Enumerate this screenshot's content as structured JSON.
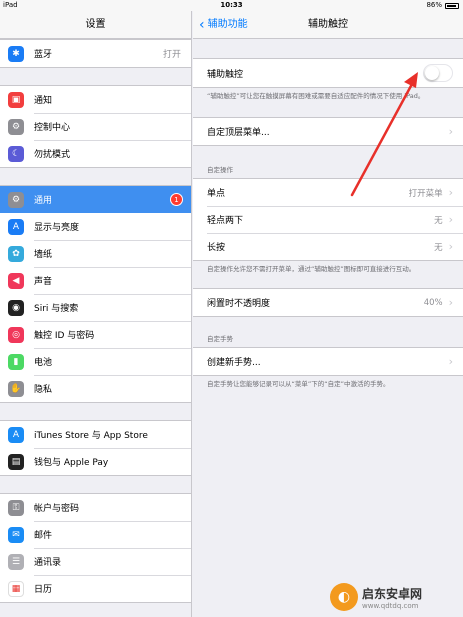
{
  "status_bar": {
    "device": "iPad",
    "time": "10:33",
    "battery": "86%",
    "battery_level": 0.86
  },
  "master": {
    "title": "设置",
    "groups": [
      [
        {
          "label": "蓝牙",
          "value": "打开",
          "icon": "bluetooth-icon",
          "color": "#1a7cf5",
          "glyph": "✱"
        }
      ],
      [
        {
          "label": "通知",
          "icon": "notification-icon",
          "color": "#f23e3e",
          "glyph": "▣"
        },
        {
          "label": "控制中心",
          "icon": "control-center-icon",
          "color": "#8e8e93",
          "glyph": "⚙"
        },
        {
          "label": "勿扰模式",
          "icon": "moon-icon",
          "color": "#5b5bd6",
          "glyph": "☾"
        }
      ],
      [
        {
          "label": "通用",
          "icon": "gear-icon",
          "color": "#8e8e93",
          "glyph": "⚙",
          "badge": "1",
          "selected": true
        },
        {
          "label": "显示与亮度",
          "icon": "display-icon",
          "color": "#1a7cf5",
          "glyph": "A"
        },
        {
          "label": "墙纸",
          "icon": "wallpaper-icon",
          "color": "#35aadc",
          "glyph": "✿"
        },
        {
          "label": "声音",
          "icon": "sound-icon",
          "color": "#f0375a",
          "glyph": "◀"
        },
        {
          "label": "Siri 与搜索",
          "icon": "siri-icon",
          "color": "#222222",
          "glyph": "◉"
        },
        {
          "label": "触控 ID 与密码",
          "icon": "fingerprint-icon",
          "color": "#f0375a",
          "glyph": "◎"
        },
        {
          "label": "电池",
          "icon": "battery-icon",
          "color": "#4cd964",
          "glyph": "▮"
        },
        {
          "label": "隐私",
          "icon": "privacy-hand-icon",
          "color": "#8e8e93",
          "glyph": "✋"
        }
      ],
      [
        {
          "label": "iTunes Store 与 App Store",
          "icon": "app-store-icon",
          "color": "#1a8cf5",
          "glyph": "A"
        },
        {
          "label": "钱包与 Apple Pay",
          "icon": "wallet-icon",
          "color": "#222222",
          "glyph": "▤"
        }
      ],
      [
        {
          "label": "帐户与密码",
          "icon": "key-icon",
          "color": "#8e8e93",
          "glyph": "⚿"
        },
        {
          "label": "邮件",
          "icon": "mail-icon",
          "color": "#1a8cf5",
          "glyph": "✉"
        },
        {
          "label": "通讯录",
          "icon": "contacts-icon",
          "color": "#b0b0b5",
          "glyph": "☰"
        },
        {
          "label": "日历",
          "icon": "calendar-icon",
          "color": "#ffffff",
          "glyph": "▦"
        }
      ]
    ]
  },
  "detail": {
    "back_label": "辅助功能",
    "title": "辅助触控",
    "assistive_touch": {
      "label": "辅助触控",
      "enabled": false,
      "footer": "“辅助触控”可让您在触摸屏幕有困难或需要自适应配件的情况下使用 iPad。"
    },
    "top_menu": {
      "label": "自定顶层菜单..."
    },
    "custom_actions": {
      "header": "自定操作",
      "rows": [
        {
          "label": "单点",
          "value": "打开菜单"
        },
        {
          "label": "轻点两下",
          "value": "无"
        },
        {
          "label": "长按",
          "value": "无"
        }
      ],
      "footer": "自定操作允许您不需打开菜单，通过“辅助触控”图标即可直接进行互动。"
    },
    "idle_opacity": {
      "label": "闲置时不透明度",
      "value": "40%"
    },
    "custom_gestures": {
      "header": "自定手势",
      "create_label": "创建新手势...",
      "footer": "自定手势让您能够记录可以从“菜单”下的“自定”中激活的手势。"
    }
  },
  "watermark": {
    "name": "启东安卓网",
    "url": "www.qdtdq.com"
  }
}
